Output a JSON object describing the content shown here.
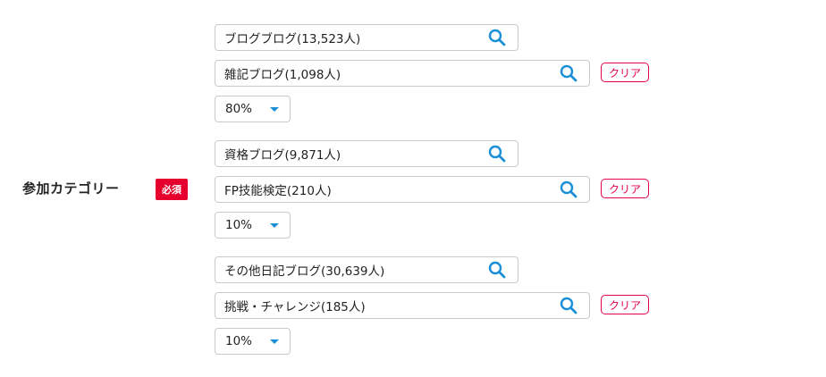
{
  "field": {
    "label": "参加カテゴリー",
    "required_badge": "必須"
  },
  "colors": {
    "accent": "#1a8fd6",
    "required": "#e5002d",
    "clear": "#e5004f",
    "border": "#c9c9c9"
  },
  "groups": [
    {
      "parent_category": "ブログブログ(13,523人)",
      "child_category": "雑記ブログ(1,098人)",
      "clear_label": "クリア",
      "ratio": "80%"
    },
    {
      "parent_category": "資格ブログ(9,871人)",
      "child_category": "FP技能検定(210人)",
      "clear_label": "クリア",
      "ratio": "10%"
    },
    {
      "parent_category": "その他日記ブログ(30,639人)",
      "child_category": "挑戦・チャレンジ(185人)",
      "clear_label": "クリア",
      "ratio": "10%"
    }
  ],
  "icons": {
    "search": "search-icon",
    "dropdown": "chevron-down-icon"
  }
}
